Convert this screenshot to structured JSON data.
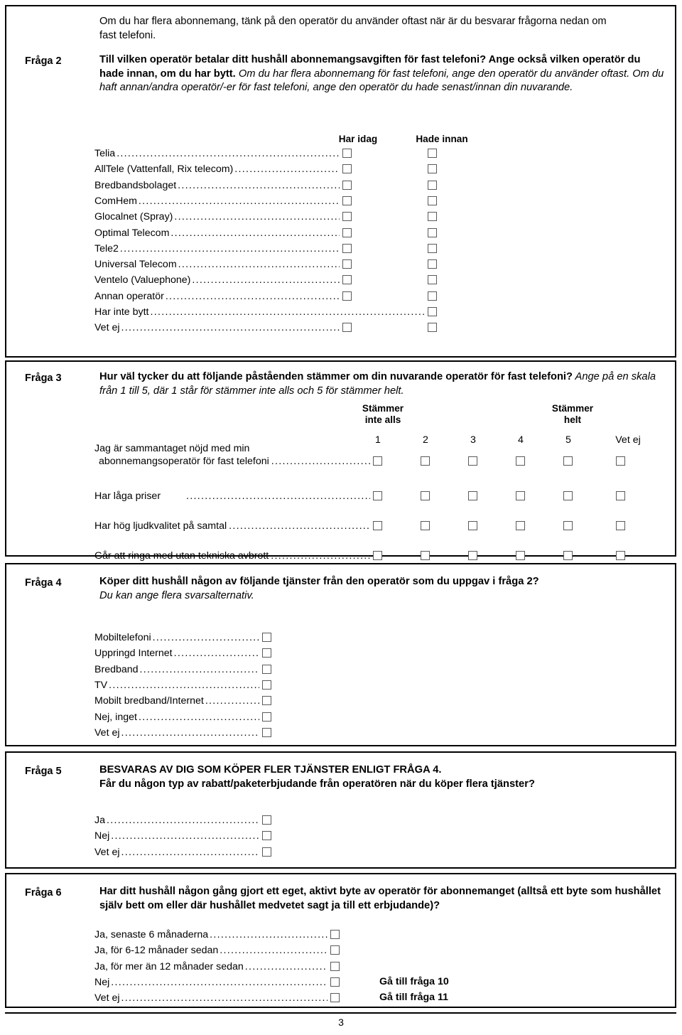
{
  "document": {
    "page_number": "3",
    "intro_text": "Om du har flera abonnemang, tänk på den operatör du använder oftast när är du besvarar frågorna nedan om fast telefoni."
  },
  "q2": {
    "label": "Fråga 2",
    "question_bold": "Till vilken operatör betalar ditt hushåll abonnemangsavgiften för fast telefoni? Ange också vilken operatör du hade innan, om du har bytt.",
    "question_italic": " Om du har flera abonnemang för fast telefoni, ange den operatör du använder oftast. Om du haft annan/andra operatör/-er för fast telefoni, ange den operatör du hade senast/innan din nuvarande.",
    "col_headers": [
      "Har idag",
      "Hade innan"
    ],
    "options": [
      {
        "label": "Telia",
        "har_idag": true,
        "hade_innan": true
      },
      {
        "label": "AllTele (Vattenfall, Rix telecom)",
        "har_idag": true,
        "hade_innan": true
      },
      {
        "label": "Bredbandsbolaget",
        "har_idag": true,
        "hade_innan": true
      },
      {
        "label": "ComHem",
        "har_idag": true,
        "hade_innan": true
      },
      {
        "label": "Glocalnet (Spray)",
        "har_idag": true,
        "hade_innan": true
      },
      {
        "label": "Optimal Telecom",
        "har_idag": true,
        "hade_innan": true
      },
      {
        "label": "Tele2",
        "har_idag": true,
        "hade_innan": true
      },
      {
        "label": "Universal Telecom",
        "har_idag": true,
        "hade_innan": true
      },
      {
        "label": "Ventelo (Valuephone)",
        "har_idag": true,
        "hade_innan": true
      },
      {
        "label": "Annan operatör",
        "har_idag": true,
        "hade_innan": true
      },
      {
        "label": "Har inte bytt",
        "har_idag": false,
        "hade_innan": true
      },
      {
        "label": "Vet ej",
        "har_idag": true,
        "hade_innan": true
      }
    ]
  },
  "q3": {
    "label": "Fråga 3",
    "question_bold": "Hur väl tycker du att följande påståenden stämmer om din nuvarande operatör för fast telefoni?",
    "question_italic": " Ange på en skala från 1 till 5, där 1 står för stämmer inte alls och 5 för stämmer helt.",
    "scale_left_line1": "Stämmer",
    "scale_left_line2": "inte alls",
    "scale_right_line1": "Stämmer",
    "scale_right_line2": "helt",
    "scale_numbers": [
      "1",
      "2",
      "3",
      "4",
      "5"
    ],
    "dontknow_label": "Vet ej",
    "statements": [
      {
        "line1": "Jag är sammantaget nöjd med min",
        "line2": "abonnemangsoperatör för fast telefoni"
      },
      {
        "line1": "",
        "line2": "Har låga priser"
      },
      {
        "line1": "",
        "line2": "Har hög ljudkvalitet på samtal"
      },
      {
        "line1": "",
        "line2": "Går att ringa med utan tekniska avbrott"
      }
    ]
  },
  "q4": {
    "label": "Fråga 4",
    "question_bold": "Köper ditt hushåll någon av följande tjänster från den operatör som du uppgav i fråga 2?",
    "question_italic": "Du kan ange flera svarsalternativ.",
    "options": [
      {
        "label": "Mobiltelefoni"
      },
      {
        "label": "Uppringd Internet"
      },
      {
        "label": "Bredband"
      },
      {
        "label": "TV"
      },
      {
        "label": "Mobilt bredband/Internet"
      },
      {
        "label": "Nej, inget"
      },
      {
        "label": "Vet ej"
      }
    ]
  },
  "q5": {
    "label": "Fråga 5",
    "question_line1": "BESVARAS AV DIG SOM KÖPER FLER TJÄNSTER ENLIGT FRÅGA 4.",
    "question_line2": "Får du någon typ av rabatt/paketerbjudande från operatören när du köper flera tjänster?",
    "options": [
      {
        "label": "Ja"
      },
      {
        "label": "Nej"
      },
      {
        "label": "Vet ej"
      }
    ]
  },
  "q6": {
    "label": "Fråga 6",
    "question_bold": "Har ditt hushåll någon gång gjort ett eget, aktivt byte av operatör för abonnemanget (alltså ett byte som hushållet själv bett om eller där hushållet medvetet sagt ja till ett erbjudande)?",
    "options": [
      {
        "label": "Ja, senaste 6 månaderna",
        "goto": ""
      },
      {
        "label": "Ja, för 6-12 månader sedan",
        "goto": ""
      },
      {
        "label": "Ja, för mer än 12 månader sedan",
        "goto": ""
      },
      {
        "label": "Nej",
        "goto": "Gå till fråga 10"
      },
      {
        "label": "Vet ej",
        "goto": "Gå till fråga 11"
      }
    ]
  },
  "colors": {
    "border": "#000000",
    "checkbox_border": "#5a5a5a",
    "text": "#000000",
    "background": "#ffffff"
  }
}
